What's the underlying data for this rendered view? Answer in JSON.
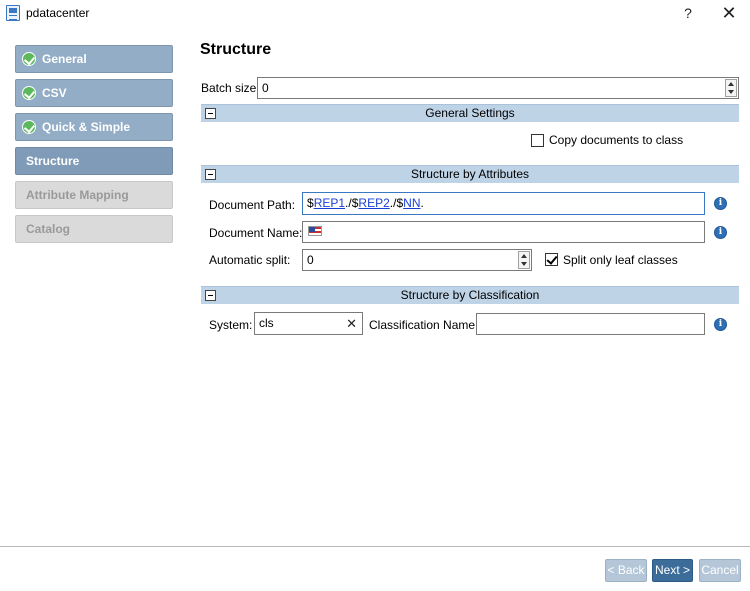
{
  "window": {
    "title": "pdatacenter",
    "help_label": "?",
    "close_label": "✕"
  },
  "sidebar": {
    "items": [
      {
        "label": "General",
        "state": "done"
      },
      {
        "label": "CSV",
        "state": "done"
      },
      {
        "label": "Quick & Simple",
        "state": "done"
      },
      {
        "label": "Structure",
        "state": "active"
      },
      {
        "label": "Attribute Mapping",
        "state": "disabled"
      },
      {
        "label": "Catalog",
        "state": "disabled"
      }
    ]
  },
  "main": {
    "title": "Structure",
    "batch_size": {
      "label": "Batch size:",
      "value": "0"
    },
    "general_settings": {
      "header": "General Settings",
      "copy_documents": {
        "label": "Copy documents to class",
        "checked": false
      }
    },
    "structure_by_attributes": {
      "header": "Structure by Attributes",
      "document_path": {
        "label": "Document Path:",
        "tokens": [
          "$",
          "REP1",
          ".",
          "/",
          "$",
          "REP2",
          ".",
          "/",
          "$",
          "NN",
          "."
        ]
      },
      "document_name": {
        "label": "Document Name:",
        "value": ""
      },
      "automatic_split": {
        "label": "Automatic split:",
        "value": "0"
      },
      "split_only_leaf": {
        "label": "Split only leaf classes",
        "checked": true
      }
    },
    "structure_by_classification": {
      "header": "Structure by Classification",
      "system": {
        "label": "System:",
        "value": "cls",
        "clear_label": "✕"
      },
      "classification_name": {
        "label": "Classification Name:",
        "value": ""
      }
    }
  },
  "footer": {
    "back_label": "< Back",
    "next_label": "Next >",
    "cancel_label": "Cancel"
  },
  "colors": {
    "nav_done": "#93adc6",
    "nav_active": "#7f9bb7",
    "nav_disabled": "#dadada",
    "section_header": "#bfd3e6",
    "primary_button": "#3c6d9a",
    "link": "#1a3fd6",
    "check_green": "#5cb85c",
    "info_blue": "#2f6fb5"
  }
}
